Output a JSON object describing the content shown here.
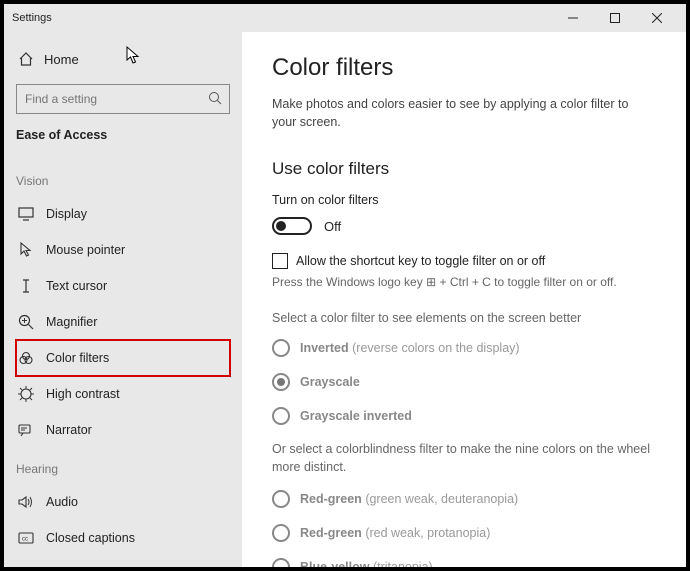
{
  "window": {
    "title": "Settings"
  },
  "sidebar": {
    "home": "Home",
    "search_placeholder": "Find a setting",
    "category": "Ease of Access",
    "groups": [
      {
        "label": "Vision",
        "items": [
          {
            "icon": "display-icon",
            "label": "Display"
          },
          {
            "icon": "mouse-pointer-icon",
            "label": "Mouse pointer"
          },
          {
            "icon": "text-cursor-icon",
            "label": "Text cursor"
          },
          {
            "icon": "magnifier-icon",
            "label": "Magnifier"
          },
          {
            "icon": "color-filters-icon",
            "label": "Color filters",
            "selected": true
          },
          {
            "icon": "high-contrast-icon",
            "label": "High contrast"
          },
          {
            "icon": "narrator-icon",
            "label": "Narrator"
          }
        ]
      },
      {
        "label": "Hearing",
        "items": [
          {
            "icon": "audio-icon",
            "label": "Audio"
          },
          {
            "icon": "closed-captions-icon",
            "label": "Closed captions"
          }
        ]
      }
    ]
  },
  "main": {
    "title": "Color filters",
    "description": "Make photos and colors easier to see by applying a color filter to your screen.",
    "section_heading": "Use color filters",
    "toggle_label": "Turn on color filters",
    "toggle_state": "Off",
    "shortcut_checkbox_label": "Allow the shortcut key to toggle filter on or off",
    "shortcut_hint_pre": "Press the Windows logo key ",
    "shortcut_hint_post": " + Ctrl + C to toggle filter on or off.",
    "filter_select_label": "Select a color filter to see elements on the screen better",
    "filters": [
      {
        "name": "Inverted",
        "paren": "(reverse colors on the display)"
      },
      {
        "name": "Grayscale",
        "paren": "",
        "selected": true
      },
      {
        "name": "Grayscale inverted",
        "paren": ""
      }
    ],
    "cb_intro": "Or select a colorblindness filter to make the nine colors on the wheel more distinct.",
    "cb_filters": [
      {
        "name": "Red-green",
        "paren": "(green weak, deuteranopia)"
      },
      {
        "name": "Red-green",
        "paren": "(red weak, protanopia)"
      },
      {
        "name": "Blue-yellow",
        "paren": "(tritanopia)"
      }
    ]
  }
}
